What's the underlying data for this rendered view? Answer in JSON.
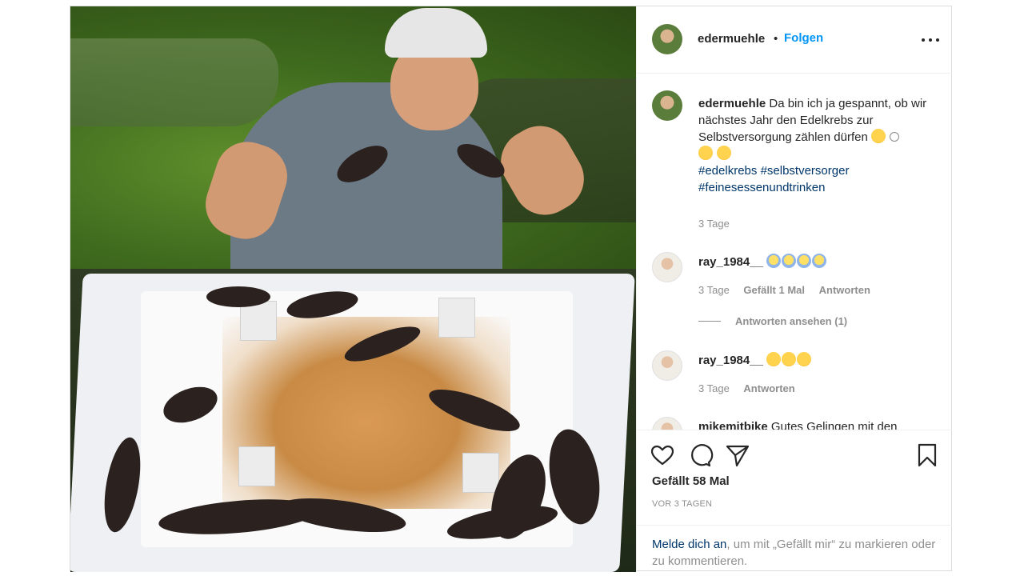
{
  "post": {
    "author": "edermuehle",
    "separator": "•",
    "follow_label": "Folgen",
    "more_icon": "more-horizontal-icon"
  },
  "caption": {
    "username": "edermuehle",
    "text": "Da bin ich ja gespannt, ob wir nächstes Jahr den Edelkrebs zur Selbstversorgung zählen dürfen",
    "hashtags": [
      "#edelkrebs",
      "#selbstversorger",
      "#feinesessenundtrinken"
    ],
    "time": "3 Tage"
  },
  "comments": [
    {
      "username": "ray_1984__",
      "emoji_count": 4,
      "emoji_type": "face-screaming-emoji",
      "time": "3 Tage",
      "likes": "Gefällt 1 Mal",
      "reply_label": "Antworten",
      "view_replies": "Antworten ansehen (1)"
    },
    {
      "username": "ray_1984__",
      "emoji_count": 3,
      "emoji_type": "grinning-emoji",
      "time": "3 Tage",
      "reply_label": "Antworten"
    },
    {
      "username": "mikemitbike",
      "text": "Gutes Gelingen mit den"
    }
  ],
  "actions": {
    "like_icon": "heart-icon",
    "comment_icon": "comment-icon",
    "share_icon": "share-icon",
    "save_icon": "bookmark-icon"
  },
  "likes_text": "Gefällt 58 Mal",
  "date_text": "VOR 3 TAGEN",
  "login": {
    "link": "Melde dich an",
    "rest": ", um mit „Gefällt mir“ zu markieren oder zu kommentieren."
  },
  "colors": {
    "follow_blue": "#0095f6",
    "hashtag_blue": "#00376b",
    "muted": "#8e8e8e",
    "text": "#262626"
  }
}
